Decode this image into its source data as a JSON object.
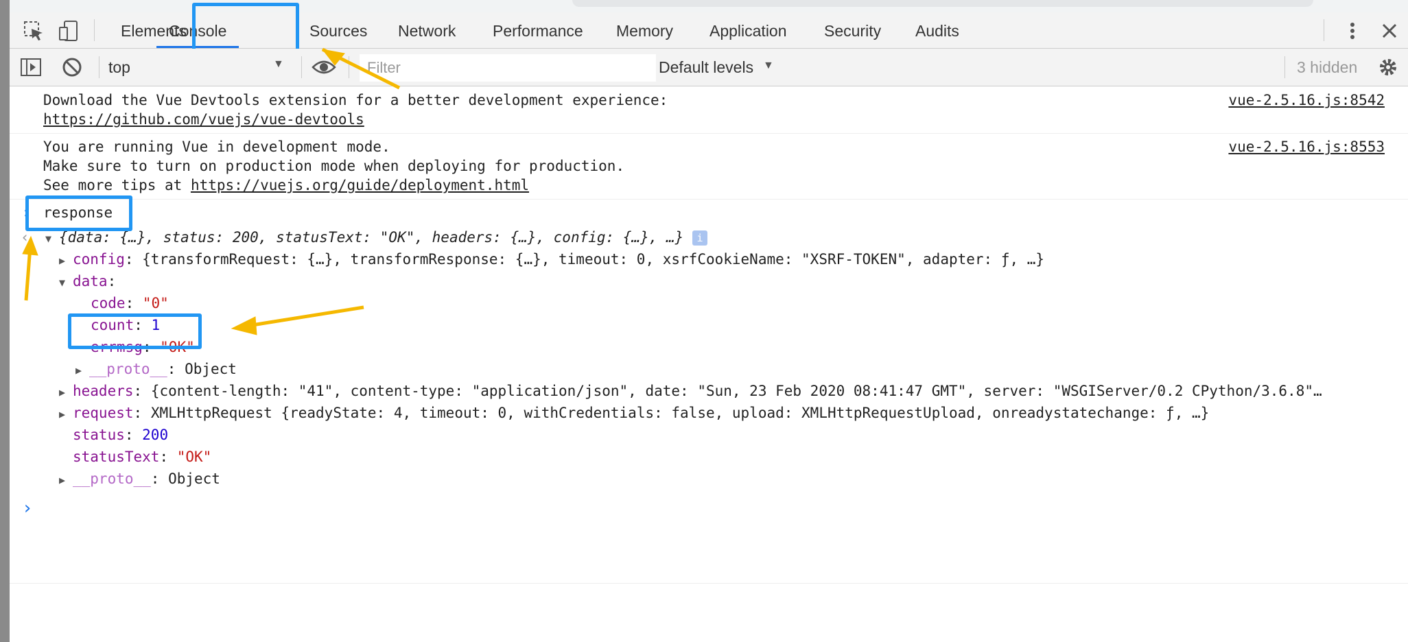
{
  "tabs": [
    "Elements",
    "Console",
    "Sources",
    "Network",
    "Performance",
    "Memory",
    "Application",
    "Security",
    "Audits"
  ],
  "toolbar": {
    "context": "top",
    "filter_placeholder": "Filter",
    "levels": "Default levels",
    "hidden": "3 hidden"
  },
  "messages": [
    {
      "lines": [
        "Download the Vue Devtools extension for a better development experience:"
      ],
      "link": "https://github.com/vuejs/vue-devtools",
      "source": "vue-2.5.16.js:8542"
    },
    {
      "lines": [
        "You are running Vue in development mode.",
        "Make sure to turn on production mode when deploying for production."
      ],
      "tip_prefix": "See more tips at ",
      "link": "https://vuejs.org/guide/deployment.html",
      "source": "vue-2.5.16.js:8553"
    }
  ],
  "input": "response",
  "result": {
    "summary": "{data: {…}, status: 200, statusText: \"OK\", headers: {…}, config: {…}, …}",
    "config": {
      "key": "config",
      "value": "{transformRequest: {…}, transformResponse: {…}, timeout: 0, xsrfCookieName: \"XSRF-TOKEN\", adapter: ƒ, …}"
    },
    "data_key": "data",
    "data_items": [
      {
        "key": "code",
        "value": "\"0\""
      },
      {
        "key": "count",
        "value": "1"
      },
      {
        "key": "errmsg",
        "value": "\"OK\""
      }
    ],
    "proto_key": "__proto__",
    "proto_value": "Object",
    "headers": {
      "key": "headers",
      "value": "{content-length: \"41\", content-type: \"application/json\", date: \"Sun, 23 Feb 2020 08:41:47 GMT\", server: \"WSGIServer/0.2 CPython/3.6.8\"…"
    },
    "request": {
      "key": "request",
      "value": "XMLHttpRequest {readyState: 4, timeout: 0, withCredentials: false, upload: XMLHttpRequestUpload, onreadystatechange: ƒ, …}"
    },
    "status": {
      "key": "status",
      "value": "200"
    },
    "statusText": {
      "key": "statusText",
      "value": "\"OK\""
    }
  },
  "colors": {
    "highlight": "#2196f3",
    "arrow": "#f5b800",
    "active_tab": "#1a73e8"
  },
  "icons": [
    "inspect-icon",
    "device-icon",
    "more-vert-icon",
    "close-icon",
    "sidebar-toggle-icon",
    "clear-console-icon",
    "eye-icon",
    "gear-icon",
    "info-icon",
    "prompt-icon"
  ]
}
